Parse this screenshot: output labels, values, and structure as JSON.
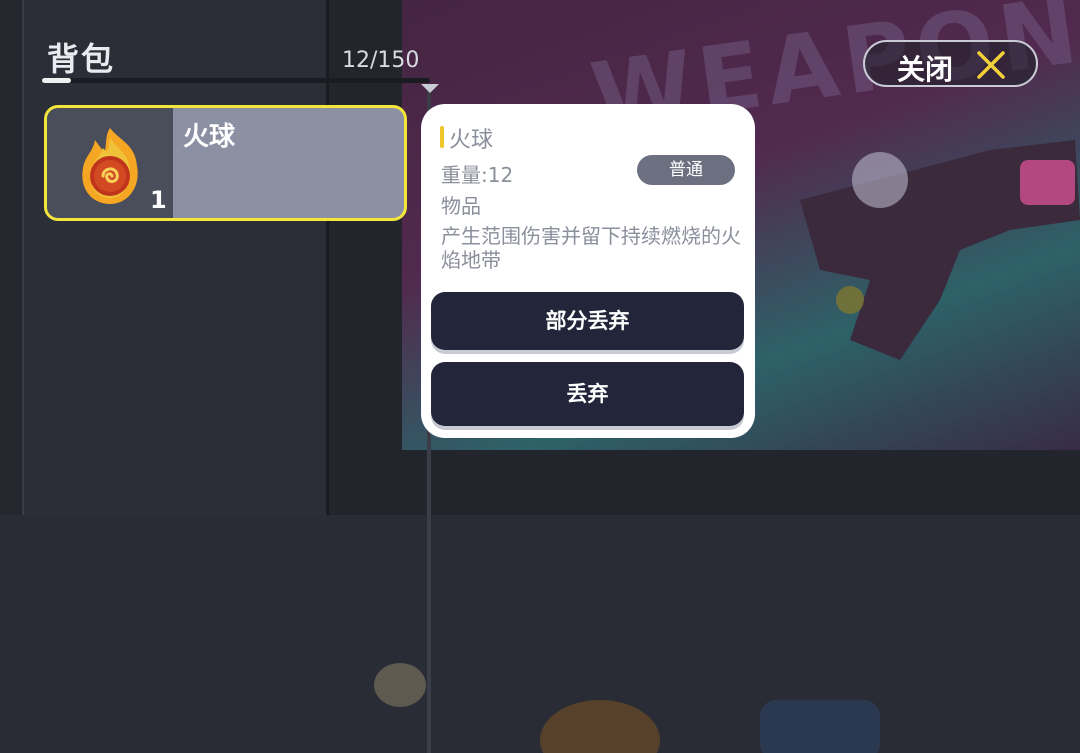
{
  "header": {
    "title": "背包",
    "capacity": "12/150",
    "close_label": "关闭"
  },
  "inventory": {
    "items": [
      {
        "name": "火球",
        "quantity": "1",
        "icon": "fireball-icon",
        "selected": true
      }
    ]
  },
  "detail": {
    "name": "火球",
    "weight": "重量:12",
    "rarity": "普通",
    "type": "物品",
    "description": "产生范围伤害并留下持续燃烧的火焰地带",
    "actions": {
      "partial_drop": "部分丢弃",
      "drop": "丢弃"
    }
  },
  "colors": {
    "selected_border": "#f2e63a",
    "card_bg": "#ffffff",
    "button_bg": "#23263a",
    "accent_bar": "#f0c52a",
    "close_icon": "#f2d13a"
  }
}
